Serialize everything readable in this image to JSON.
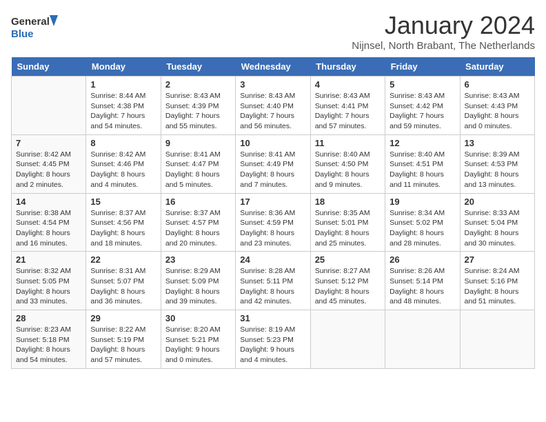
{
  "header": {
    "logo": {
      "general": "General",
      "blue": "Blue"
    },
    "title": "January 2024",
    "subtitle": "Nijnsel, North Brabant, The Netherlands"
  },
  "days_of_week": [
    "Sunday",
    "Monday",
    "Tuesday",
    "Wednesday",
    "Thursday",
    "Friday",
    "Saturday"
  ],
  "weeks": [
    [
      {
        "day": "",
        "details": ""
      },
      {
        "day": "1",
        "details": "Sunrise: 8:44 AM\nSunset: 4:38 PM\nDaylight: 7 hours\nand 54 minutes."
      },
      {
        "day": "2",
        "details": "Sunrise: 8:43 AM\nSunset: 4:39 PM\nDaylight: 7 hours\nand 55 minutes."
      },
      {
        "day": "3",
        "details": "Sunrise: 8:43 AM\nSunset: 4:40 PM\nDaylight: 7 hours\nand 56 minutes."
      },
      {
        "day": "4",
        "details": "Sunrise: 8:43 AM\nSunset: 4:41 PM\nDaylight: 7 hours\nand 57 minutes."
      },
      {
        "day": "5",
        "details": "Sunrise: 8:43 AM\nSunset: 4:42 PM\nDaylight: 7 hours\nand 59 minutes."
      },
      {
        "day": "6",
        "details": "Sunrise: 8:43 AM\nSunset: 4:43 PM\nDaylight: 8 hours\nand 0 minutes."
      }
    ],
    [
      {
        "day": "7",
        "details": "Sunrise: 8:42 AM\nSunset: 4:45 PM\nDaylight: 8 hours\nand 2 minutes."
      },
      {
        "day": "8",
        "details": "Sunrise: 8:42 AM\nSunset: 4:46 PM\nDaylight: 8 hours\nand 4 minutes."
      },
      {
        "day": "9",
        "details": "Sunrise: 8:41 AM\nSunset: 4:47 PM\nDaylight: 8 hours\nand 5 minutes."
      },
      {
        "day": "10",
        "details": "Sunrise: 8:41 AM\nSunset: 4:49 PM\nDaylight: 8 hours\nand 7 minutes."
      },
      {
        "day": "11",
        "details": "Sunrise: 8:40 AM\nSunset: 4:50 PM\nDaylight: 8 hours\nand 9 minutes."
      },
      {
        "day": "12",
        "details": "Sunrise: 8:40 AM\nSunset: 4:51 PM\nDaylight: 8 hours\nand 11 minutes."
      },
      {
        "day": "13",
        "details": "Sunrise: 8:39 AM\nSunset: 4:53 PM\nDaylight: 8 hours\nand 13 minutes."
      }
    ],
    [
      {
        "day": "14",
        "details": "Sunrise: 8:38 AM\nSunset: 4:54 PM\nDaylight: 8 hours\nand 16 minutes."
      },
      {
        "day": "15",
        "details": "Sunrise: 8:37 AM\nSunset: 4:56 PM\nDaylight: 8 hours\nand 18 minutes."
      },
      {
        "day": "16",
        "details": "Sunrise: 8:37 AM\nSunset: 4:57 PM\nDaylight: 8 hours\nand 20 minutes."
      },
      {
        "day": "17",
        "details": "Sunrise: 8:36 AM\nSunset: 4:59 PM\nDaylight: 8 hours\nand 23 minutes."
      },
      {
        "day": "18",
        "details": "Sunrise: 8:35 AM\nSunset: 5:01 PM\nDaylight: 8 hours\nand 25 minutes."
      },
      {
        "day": "19",
        "details": "Sunrise: 8:34 AM\nSunset: 5:02 PM\nDaylight: 8 hours\nand 28 minutes."
      },
      {
        "day": "20",
        "details": "Sunrise: 8:33 AM\nSunset: 5:04 PM\nDaylight: 8 hours\nand 30 minutes."
      }
    ],
    [
      {
        "day": "21",
        "details": "Sunrise: 8:32 AM\nSunset: 5:05 PM\nDaylight: 8 hours\nand 33 minutes."
      },
      {
        "day": "22",
        "details": "Sunrise: 8:31 AM\nSunset: 5:07 PM\nDaylight: 8 hours\nand 36 minutes."
      },
      {
        "day": "23",
        "details": "Sunrise: 8:29 AM\nSunset: 5:09 PM\nDaylight: 8 hours\nand 39 minutes."
      },
      {
        "day": "24",
        "details": "Sunrise: 8:28 AM\nSunset: 5:11 PM\nDaylight: 8 hours\nand 42 minutes."
      },
      {
        "day": "25",
        "details": "Sunrise: 8:27 AM\nSunset: 5:12 PM\nDaylight: 8 hours\nand 45 minutes."
      },
      {
        "day": "26",
        "details": "Sunrise: 8:26 AM\nSunset: 5:14 PM\nDaylight: 8 hours\nand 48 minutes."
      },
      {
        "day": "27",
        "details": "Sunrise: 8:24 AM\nSunset: 5:16 PM\nDaylight: 8 hours\nand 51 minutes."
      }
    ],
    [
      {
        "day": "28",
        "details": "Sunrise: 8:23 AM\nSunset: 5:18 PM\nDaylight: 8 hours\nand 54 minutes."
      },
      {
        "day": "29",
        "details": "Sunrise: 8:22 AM\nSunset: 5:19 PM\nDaylight: 8 hours\nand 57 minutes."
      },
      {
        "day": "30",
        "details": "Sunrise: 8:20 AM\nSunset: 5:21 PM\nDaylight: 9 hours\nand 0 minutes."
      },
      {
        "day": "31",
        "details": "Sunrise: 8:19 AM\nSunset: 5:23 PM\nDaylight: 9 hours\nand 4 minutes."
      },
      {
        "day": "",
        "details": ""
      },
      {
        "day": "",
        "details": ""
      },
      {
        "day": "",
        "details": ""
      }
    ]
  ]
}
